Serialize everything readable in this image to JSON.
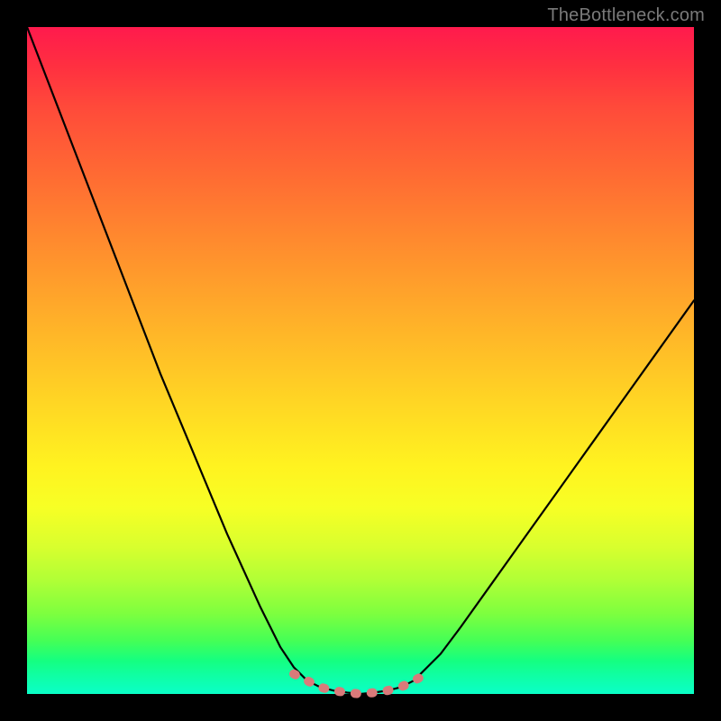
{
  "watermark": "TheBottleneck.com",
  "colors": {
    "flat_band": "#d97a7a",
    "curve": "#000000",
    "gradient_top": "#ff1a4d",
    "gradient_bottom": "#0affc8"
  },
  "chart_data": {
    "type": "line",
    "title": "",
    "subtitle": "",
    "xlabel": "",
    "ylabel": "",
    "xlim": [
      0,
      100
    ],
    "ylim": [
      0,
      100
    ],
    "grid": false,
    "legend": false,
    "annotations": [
      "TheBottleneck.com"
    ],
    "note": "Bottleneck-style V curve; x = relative component balance, y = bottleneck %, minimum ≈ 0 near center; axes unlabeled so values are read proportionally from plot extents.",
    "series": [
      {
        "name": "bottleneck",
        "x": [
          0,
          5,
          10,
          15,
          20,
          25,
          30,
          35,
          38,
          40,
          42,
          44,
          46,
          48,
          50,
          52,
          54,
          56,
          58,
          60,
          62,
          65,
          70,
          75,
          80,
          85,
          90,
          95,
          100
        ],
        "y": [
          100,
          87,
          74,
          61,
          48,
          36,
          24,
          13,
          7,
          4,
          2,
          1,
          0.5,
          0.2,
          0,
          0.2,
          0.5,
          1,
          2,
          4,
          6,
          10,
          17,
          24,
          31,
          38,
          45,
          52,
          59
        ]
      },
      {
        "name": "optimal-range-marker",
        "x": [
          40,
          42,
          44,
          46,
          48,
          50,
          52,
          54,
          56,
          58,
          60
        ],
        "y": [
          3,
          2,
          1,
          0.5,
          0.2,
          0,
          0.2,
          0.5,
          1,
          2,
          3
        ]
      }
    ]
  }
}
